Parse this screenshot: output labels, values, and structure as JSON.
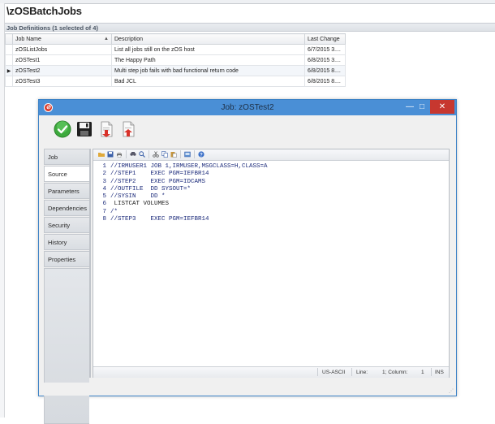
{
  "page": {
    "title": "\\zOSBatchJobs",
    "group_header": "Job Definitions (1 selected of 4)"
  },
  "grid": {
    "columns": [
      "Job Name",
      "Description",
      "Last Change"
    ],
    "rows": [
      {
        "name": "zOSListJobs",
        "description": "List all jobs still on the zOS host",
        "last_change": "6/7/2015 3...."
      },
      {
        "name": "zOSTest1",
        "description": "The Happy Path",
        "last_change": "6/8/2015 3...."
      },
      {
        "name": "zOSTest2",
        "description": "Multi step job fails with bad functional return code",
        "last_change": "6/8/2015 8...."
      },
      {
        "name": "zOSTest3",
        "description": "Bad JCL",
        "last_change": "6/8/2015 8...."
      }
    ]
  },
  "dialog": {
    "title": "Job: zOSTest2",
    "app_icon": "app-logo-icon",
    "controls": {
      "minimize": "—",
      "maximize": "□",
      "close": "✕"
    },
    "toolbar_icons": [
      "ok-check-icon",
      "save-disk-icon",
      "export-document-icon",
      "import-document-icon"
    ],
    "tabs": [
      {
        "label": "Job",
        "active": false
      },
      {
        "label": "Source",
        "active": true
      },
      {
        "label": "Parameters",
        "active": false
      },
      {
        "label": "Dependencies",
        "active": false
      },
      {
        "label": "Security",
        "active": false
      },
      {
        "label": "History",
        "active": false
      },
      {
        "label": "Properties",
        "active": false
      }
    ],
    "editor_toolbar_icons": [
      "open-folder-icon",
      "save-icon",
      "print-icon",
      "find-icon",
      "find-next-icon",
      "cut-icon",
      "copy-icon",
      "paste-icon",
      "view-icon",
      "help-icon"
    ],
    "source_lines": [
      {
        "n": "1",
        "text": "//IRMUSER1 JOB 1,IRMUSER,MSGCLASS=H,CLASS=A"
      },
      {
        "n": "2",
        "text": "//STEP1    EXEC PGM=IEFBR14"
      },
      {
        "n": "3",
        "text": "//STEP2    EXEC PGM=IDCAMS"
      },
      {
        "n": "4",
        "text": "//OUTFILE  DD SYSOUT=*"
      },
      {
        "n": "5",
        "text": "//SYSIN    DD *"
      },
      {
        "n": "6",
        "text": " LISTCAT VOLUMES"
      },
      {
        "n": "7",
        "text": "/*"
      },
      {
        "n": "8",
        "text": "//STEP3    EXEC PGM=IEFBR14"
      }
    ],
    "status": {
      "encoding": "US-ASCII",
      "line_label": "Line:",
      "line_value": "1; Column:",
      "column_value": "1",
      "mode": "INS"
    }
  }
}
